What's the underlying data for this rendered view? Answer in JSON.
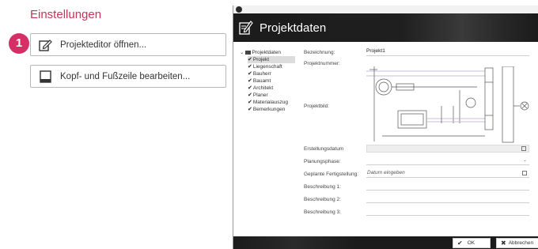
{
  "settings": {
    "title": "Einstellungen",
    "step_number": "1",
    "buttons": [
      {
        "label": "Projekteditor öffnen...",
        "icon": "edit-document-icon"
      },
      {
        "label": "Kopf- und Fußzeile bearbeiten...",
        "icon": "page-footer-icon"
      }
    ]
  },
  "dialog": {
    "title": "Projektdaten",
    "tree": {
      "root": "Projektdaten",
      "items": [
        "Projekt",
        "Liegenschaft",
        "Bauherr",
        "Bauamt",
        "Architekt",
        "Planer",
        "Materialauszug",
        "Bemerkungen"
      ],
      "selected": "Projekt"
    },
    "form": {
      "bezeichnung_label": "Bezeichnung:",
      "bezeichnung_value": "Projekt1",
      "projektnummer_label": "Projektnummer:",
      "projektbild_label": "Projektbild:",
      "erstellungsdatum_label": "Erstellungsdatum",
      "planungsphase_label": "Planungsphase:",
      "fertigstellung_label": "Geplante Fertigstellung:",
      "fertigstellung_placeholder": "Datum eingeben",
      "beschreibung1_label": "Beschreibung 1:",
      "beschreibung2_label": "Beschreibung 2:",
      "beschreibung3_label": "Beschreibung 3:"
    },
    "footer": {
      "ok_label": "OK",
      "cancel_label": "Abbrechen"
    }
  },
  "colors": {
    "accent": "#d72e66",
    "title": "#c8325a",
    "header_bg": "#1b1b1b"
  }
}
